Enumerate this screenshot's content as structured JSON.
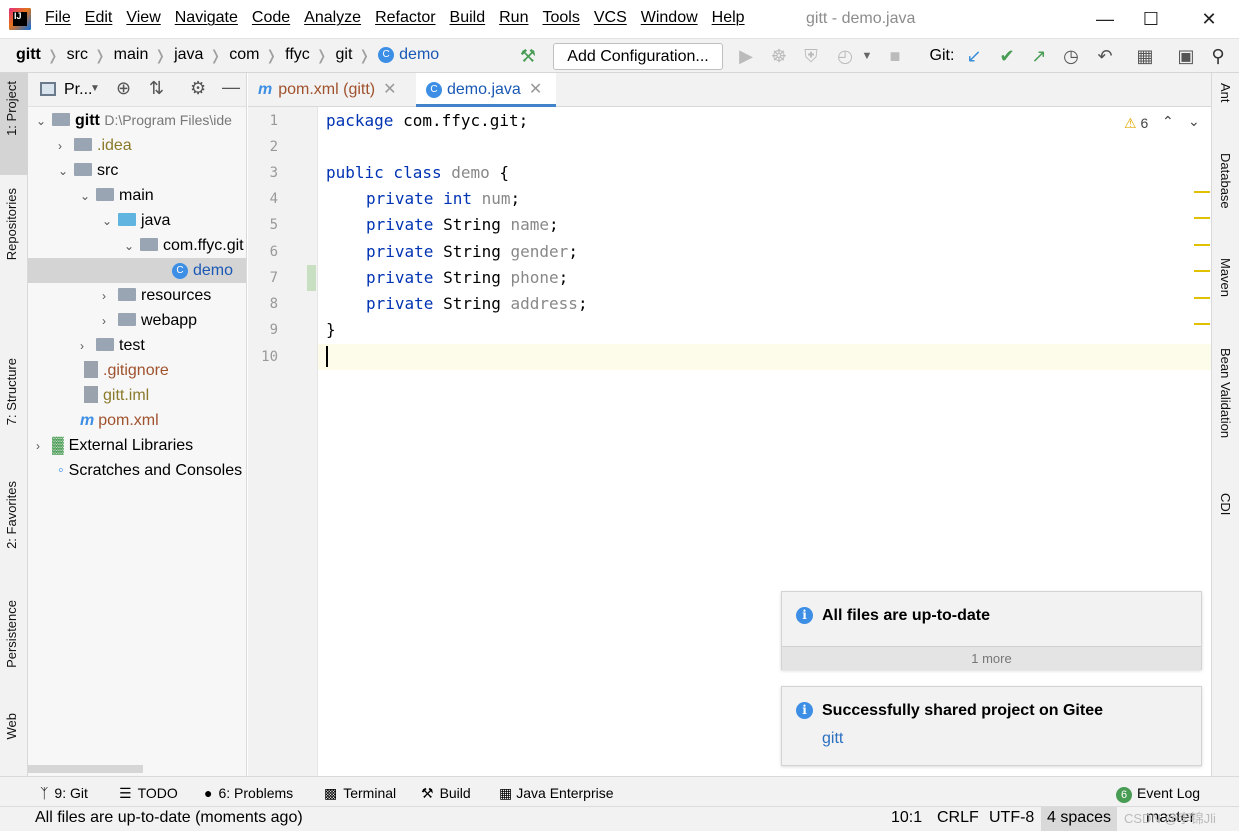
{
  "menu": [
    "File",
    "Edit",
    "View",
    "Navigate",
    "Code",
    "Analyze",
    "Refactor",
    "Build",
    "Run",
    "Tools",
    "VCS",
    "Window",
    "Help"
  ],
  "window_title": "gitt - demo.java",
  "breadcrumbs": [
    "gitt",
    "src",
    "main",
    "java",
    "com",
    "ffyc",
    "git",
    "demo"
  ],
  "toolbar": {
    "add_config": "Add Configuration...",
    "git_label": "Git:"
  },
  "left_tools": [
    "1: Project",
    "Repositories",
    "7: Structure",
    "2: Favorites",
    "Persistence",
    "Web"
  ],
  "right_tools": [
    "Ant",
    "Database",
    "Maven",
    "Bean Validation",
    "CDI"
  ],
  "project": {
    "header": "Pr...",
    "root_name": "gitt",
    "root_path": "D:\\Program Files\\ide",
    "items": [
      ".idea",
      "src",
      "main",
      "java",
      "com.ffyc.git",
      "demo",
      "resources",
      "webapp",
      "test",
      ".gitignore",
      "gitt.iml",
      "pom.xml",
      "External Libraries",
      "Scratches and Consoles"
    ]
  },
  "tabs": [
    {
      "label": "pom.xml (gitt)"
    },
    {
      "label": "demo.java"
    }
  ],
  "editor": {
    "warnings": "6",
    "line_numbers": [
      "1",
      "2",
      "3",
      "4",
      "5",
      "6",
      "7",
      "8",
      "9",
      "10"
    ]
  },
  "code": {
    "l1_kw": "package",
    "l1_rest": " com.ffyc.git;",
    "l3_kw": "public class",
    "l3_name": " demo",
    "l3_rest": " {",
    "private": "private",
    "int": "int",
    "String": "String",
    "f1": " num",
    "f2": " name",
    "f3": " gender",
    "f4": " phone",
    "f5": " address",
    "semi": ";",
    "close": "}"
  },
  "notifications": [
    {
      "title": "All files are up-to-date",
      "more": "1 more"
    },
    {
      "title": "Successfully shared project on Gitee",
      "link": "gitt"
    }
  ],
  "bottom_tabs": {
    "git": "9: Git",
    "todo": "TODO",
    "problems": "6: Problems",
    "terminal": "Terminal",
    "build": "Build",
    "java_ent": "Java Enterprise",
    "event_log": "Event Log",
    "event_count": "6"
  },
  "status": {
    "message": "All files are up-to-date (moments ago)",
    "position": "10:1",
    "line_sep": "CRLF",
    "encoding": "UTF-8",
    "indent": "4 spaces",
    "branch": "master",
    "watermark": "CSDN @李锦Jli"
  }
}
